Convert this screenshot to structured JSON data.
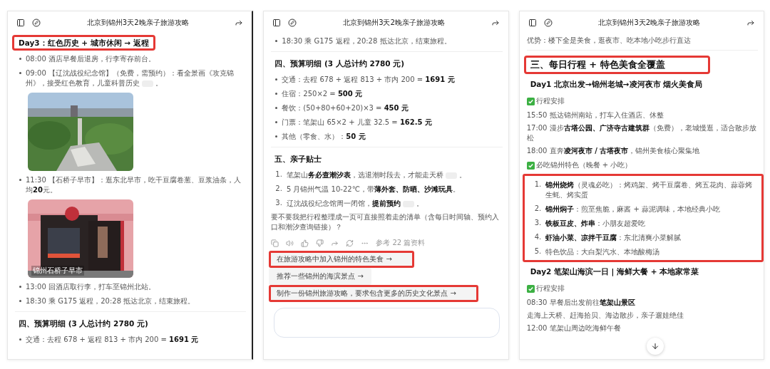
{
  "panels": [
    {
      "title": "北京到锦州3天2晚亲子旅游攻略",
      "blocks": [
        {
          "kind": "subheading",
          "text": "Day3：红色历史 + 城市休闲 → 返程",
          "highlighted": true
        },
        {
          "kind": "bullet",
          "text": "08:00 酒店早餐后退房，行李寄存前台。"
        },
        {
          "kind": "bullet",
          "text": "09:00 【辽沈战役纪念馆】（免费，需预约）：看全景画《攻克锦州》，接受红色教育，儿童科普历史",
          "cite": true,
          "tail": "。"
        },
        {
          "kind": "picture"
        },
        {
          "kind": "bullet",
          "text": "11:30 【石桥子早市】：逛东北早市，吃干豆腐卷葱、豆浆油条，人均**20**元。"
        },
        {
          "kind": "picture",
          "caption": "锦州石桥子早市"
        },
        {
          "kind": "bullet",
          "text": "13:00 回酒店取行李，打车至锦州北站。"
        },
        {
          "kind": "bullet",
          "text": "18:30 乘 G175 返程，20:28 抵达北京，结束旅程。"
        },
        {
          "kind": "divider"
        },
        {
          "kind": "subheading",
          "text": "四、预算明细 (3 人总计约 2780 元)",
          "highlighted": false
        },
        {
          "kind": "bullet",
          "text": "交通：去程 678 + 返程 813 + 市内 200 = **1691 元**"
        }
      ]
    },
    {
      "title": "北京到锦州3天2晚亲子旅游攻略",
      "blocks": [
        {
          "kind": "bullet",
          "text": "18:30 乘 G175 返程，20:28 抵达北京，结束旅程。"
        },
        {
          "kind": "divider"
        },
        {
          "kind": "subheading",
          "text": "四、预算明细 (3 人总计约 2780 元)",
          "highlighted": false
        },
        {
          "kind": "bullet",
          "text": "交通：去程 678 + 返程 813 + 市内 200 = **1691 元**"
        },
        {
          "kind": "bullet",
          "text": "住宿：250×2 = **500 元**"
        },
        {
          "kind": "bullet",
          "text": "餐饮：(50+80+60+20)×3 = **450 元**"
        },
        {
          "kind": "bullet",
          "text": "门票：笔架山 65×2 + 儿童 32.5 = **162.5 元**"
        },
        {
          "kind": "bullet",
          "text": "其他（零食、水）：**50 元**"
        },
        {
          "kind": "divider"
        },
        {
          "kind": "subheading",
          "text": "五、亲子贴士",
          "highlighted": false
        },
        {
          "kind": "numbered",
          "number": "1.",
          "text": "笔架山**务必查潮汐表**，选退潮时段去，才能走天桥",
          "cite": true,
          "tail": "。"
        },
        {
          "kind": "numbered",
          "number": "2.",
          "text": "5 月锦州气温 10-22℃，带**薄外套、防晒、沙滩玩具**。"
        },
        {
          "kind": "numbered",
          "number": "3.",
          "text": "辽沈战役纪念馆周一闭馆，**提前预约**",
          "cite": true,
          "tail": "。"
        },
        {
          "kind": "paragraph",
          "text": "要不要我把行程整理成一页可直接照着走的清单（含每日时间轴、预约入口和潮汐查询链接）？"
        },
        {
          "kind": "actions",
          "sources": "参考 22 篇资料"
        },
        {
          "kind": "suggestion",
          "text": "在旅游攻略中加入锦州的特色美食 →",
          "highlighted": true
        },
        {
          "kind": "suggestion",
          "text": "推荐一些锦州的海滨景点 →",
          "highlighted": false
        },
        {
          "kind": "suggestion",
          "text": "制作一份锦州旅游攻略，要求包含更多的历史文化景点 →",
          "highlighted": true
        },
        {
          "kind": "composer"
        }
      ]
    },
    {
      "title": "北京到锦州3天2晚亲子旅游攻略",
      "blocks": [
        {
          "kind": "paragraph",
          "text": "优势：楼下全是美食，逛夜市、吃本地小吃步行直达"
        },
        {
          "kind": "divider"
        },
        {
          "kind": "heading",
          "text": "三、每日行程 + 特色美食全覆盖",
          "highlighted": true
        },
        {
          "kind": "subheading",
          "text": "Day1 北京出发→锦州老城→凌河夜市 烟火美食局",
          "highlighted": false
        },
        {
          "kind": "check",
          "text": "行程安排"
        },
        {
          "kind": "paragraph",
          "text": "15:50 抵达锦州南站，打车入住酒店、休整"
        },
        {
          "kind": "paragraph",
          "text": "17:00 漫步**古塔公园、广济寺古建筑群**（免费），老城慢逛，适合散步放松"
        },
        {
          "kind": "paragraph",
          "text": "18:00 直奔**凌河夜市 / 古塔夜市**，锦州美食核心聚集地"
        },
        {
          "kind": "check",
          "text": "必吃锦州特色（晚餐 + 小吃）"
        },
        {
          "kind": "group",
          "highlighted": true,
          "items": [
            {
              "kind": "numbered",
              "number": "1.",
              "text": "**锦州烧烤**（灵魂必吃）：烤鸡架、烤干豆腐卷、烤五花肉、蒜蓉烤生蚝、烤实蛋"
            },
            {
              "kind": "numbered",
              "number": "2.",
              "text": "**锦州焖子**：煎至焦脆，麻酱 + 蒜泥调味，本地经典小吃"
            },
            {
              "kind": "numbered",
              "number": "3.",
              "text": "**铁板豆皮、炸串**：小朋友超爱吃"
            },
            {
              "kind": "numbered",
              "number": "4.",
              "text": "**虾油小菜、凉拌干豆腐**：东北清爽小菜解腻"
            },
            {
              "kind": "numbered",
              "number": "5.",
              "text": "特色饮品：大白梨汽水、本地酸梅汤"
            }
          ]
        },
        {
          "kind": "subheading",
          "text": "Day2 笔架山海滨一日 | 海鲜大餐 + 本地家常菜",
          "highlighted": false
        },
        {
          "kind": "check",
          "text": "行程安排"
        },
        {
          "kind": "paragraph",
          "text": "08:30 早餐后出发前往**笔架山景区**"
        },
        {
          "kind": "paragraph",
          "text": "走海上天桥、赶海拾贝、海边散步，亲子遛娃绝佳"
        },
        {
          "kind": "paragraph",
          "text": "12:00 笔架山周边吃海鲜午餐"
        },
        {
          "kind": "scroll-down"
        }
      ]
    }
  ]
}
